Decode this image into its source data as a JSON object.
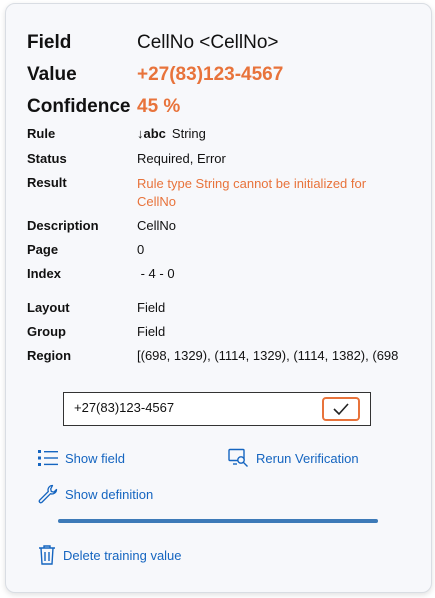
{
  "header": {
    "field_label": "Field",
    "field_value": "CellNo <CellNo>",
    "value_label": "Value",
    "value_value": "+27(83)123-4567",
    "confidence_label": "Confidence",
    "confidence_value": "45 %"
  },
  "details": {
    "rule_label": "Rule",
    "rule_type_glyph": "↓abc",
    "rule_value": "String",
    "status_label": "Status",
    "status_value": "Required, Error",
    "result_label": "Result",
    "result_value": "Rule type String cannot be initialized for CellNo",
    "description_label": "Description",
    "description_value": "CellNo",
    "page_label": "Page",
    "page_value": "0",
    "index_label": "Index",
    "index_value": " - 4 - 0",
    "layout_label": "Layout",
    "layout_value": "Field",
    "group_label": "Group",
    "group_value": "Field",
    "region_label": "Region",
    "region_value": "[(698, 1329), (1114, 1329), (1114, 1382), (698"
  },
  "editor": {
    "input_value": "+27(83)123-4567",
    "confirm_icon": "check-icon"
  },
  "actions": {
    "show_field": "Show field",
    "rerun_verification": "Rerun Verification",
    "show_definition": "Show definition",
    "delete_training_value": "Delete training value"
  },
  "progress": {
    "fraction": 1.0
  },
  "colors": {
    "accent_orange": "#e8733b",
    "link_blue": "#1565c0",
    "progress_blue": "#3d7ab8"
  }
}
